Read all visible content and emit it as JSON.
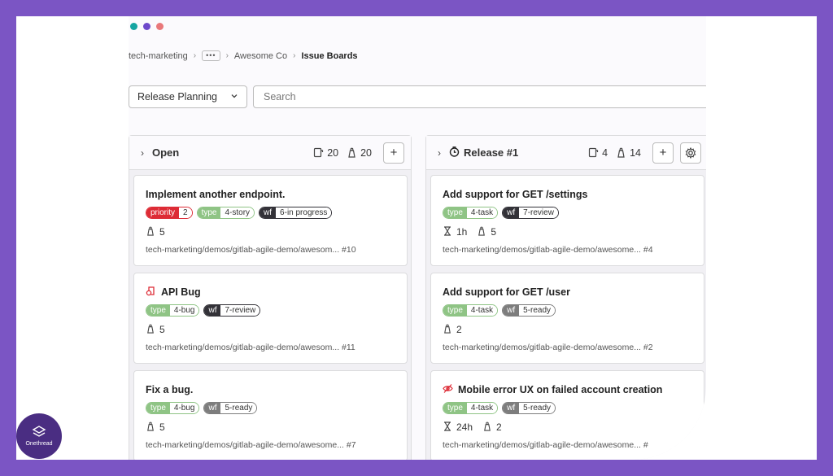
{
  "breadcrumb": {
    "items": [
      "tech-marketing",
      "Awesome Co",
      "Issue Boards"
    ],
    "more": "•••"
  },
  "filter": {
    "board": "Release Planning",
    "search_placeholder": "Search"
  },
  "columns": [
    {
      "title": "Open",
      "issues": "20",
      "weight": "20",
      "cards": [
        {
          "title": "Implement another endpoint.",
          "labels": [
            {
              "k": "priority",
              "v": "2"
            },
            {
              "k": "type",
              "v": "4-story"
            },
            {
              "k": "wf",
              "v": "6-in progress"
            }
          ],
          "weight": "5",
          "ref": "tech-marketing/demos/gitlab-agile-demo/awesom...",
          "num": "#10"
        },
        {
          "title": "API Bug",
          "labels": [
            {
              "k": "type",
              "v": "4-bug"
            },
            {
              "k": "wf",
              "v": "7-review"
            }
          ],
          "weight": "5",
          "ref": "tech-marketing/demos/gitlab-agile-demo/awesom...",
          "num": "#11"
        },
        {
          "title": "Fix a bug.",
          "labels": [
            {
              "k": "type",
              "v": "4-bug"
            },
            {
              "k": "wf",
              "v": "5-ready"
            }
          ],
          "weight": "5",
          "ref": "tech-marketing/demos/gitlab-agile-demo/awesome...",
          "num": "#7"
        }
      ]
    },
    {
      "title": "Release #1",
      "issues": "4",
      "weight": "14",
      "cards": [
        {
          "title": "Add support for GET /settings",
          "labels": [
            {
              "k": "type",
              "v": "4-task"
            },
            {
              "k": "wf",
              "v": "7-review"
            }
          ],
          "time": "1h",
          "weight": "5",
          "ref": "tech-marketing/demos/gitlab-agile-demo/awesome...",
          "num": "#4"
        },
        {
          "title": "Add support for GET /user",
          "labels": [
            {
              "k": "type",
              "v": "4-task"
            },
            {
              "k": "wf",
              "v": "5-ready"
            }
          ],
          "weight": "2",
          "ref": "tech-marketing/demos/gitlab-agile-demo/awesome...",
          "num": "#2"
        },
        {
          "title": "Mobile error UX on failed account creation",
          "labels": [
            {
              "k": "type",
              "v": "4-task"
            },
            {
              "k": "wf",
              "v": "5-ready"
            }
          ],
          "time": "24h",
          "weight": "2",
          "ref": "tech-marketing/demos/gitlab-agile-demo/awesome...",
          "num": "#"
        }
      ]
    }
  ],
  "colors": {
    "priority": "#dd2b35",
    "type": "#8fc485",
    "wf_dark": "#333238",
    "wf_gray": "#7d7d7d",
    "window_dots": [
      "#16a5a2",
      "#6e49cb",
      "#e9787a"
    ]
  },
  "logo": {
    "text": "Onethread"
  }
}
